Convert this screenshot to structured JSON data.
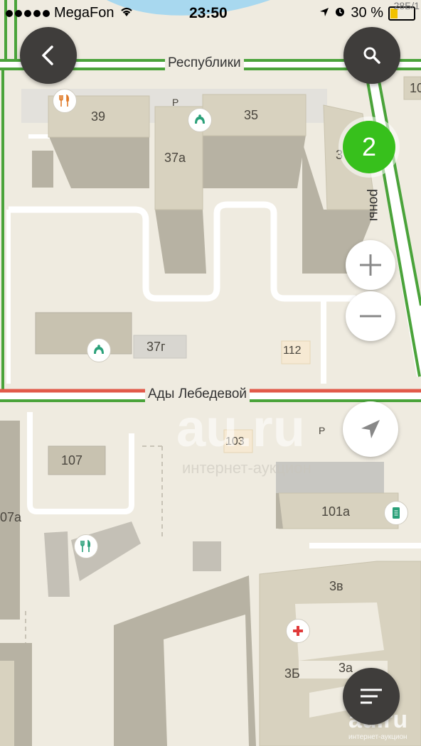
{
  "status_bar": {
    "carrier": "MegaFon",
    "time": "23:50",
    "battery_percent": "30 %",
    "corner_text": "28Б/1"
  },
  "streets": {
    "top": "Республики",
    "middle": "Ады Лебедевой",
    "right_partial": "роны"
  },
  "buildings": {
    "b39": "39",
    "b35": "35",
    "b37a": "37а",
    "b3x": "3",
    "b37g": "37г",
    "b112": "112",
    "b103": "103",
    "b107": "107",
    "b107a": "07а",
    "b101a": "101а",
    "b3v": "3в",
    "b3b": "3Б",
    "b3a": "3а",
    "b10": "10"
  },
  "parking": {
    "p1": "P",
    "p2": "P"
  },
  "cluster_badge": "2",
  "watermark": {
    "big": "au.ru",
    "sub": "интернет-аукцион",
    "corner": "au.ru",
    "corner_sub": "интернет-аукцион"
  },
  "colors": {
    "map_bg": "#efebe0",
    "building": "#d8d2bf",
    "building_dark": "#b7b2a3",
    "road_green": "#4aa33a",
    "road_red": "#e25a4a",
    "badge": "#37c01c"
  },
  "icons": [
    "back-icon",
    "search-icon",
    "plus-icon",
    "minus-icon",
    "location-arrow-icon",
    "menu-icon",
    "restaurant-icon",
    "cafe-icon",
    "atm-icon",
    "hospital-icon",
    "mobile-icon"
  ]
}
